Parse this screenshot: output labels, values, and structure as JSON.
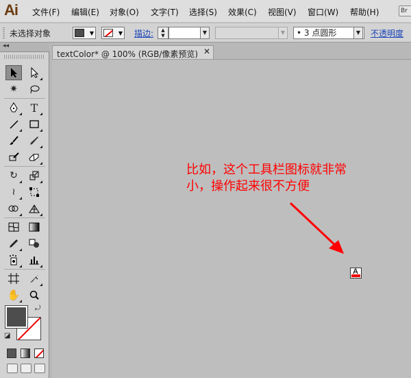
{
  "app": {
    "logo": "Ai",
    "bridge_badge": "Br"
  },
  "menu": [
    "文件(F)",
    "编辑(E)",
    "对象(O)",
    "文字(T)",
    "选择(S)",
    "效果(C)",
    "视图(V)",
    "窗口(W)",
    "帮助(H)"
  ],
  "control": {
    "selection_label": "未选择对象",
    "stroke_label": "描边:",
    "brush_value": "• 3 点圆形",
    "opacity_label": "不透明度",
    "fill_color": "#4d4d4d",
    "stroke_color": "none"
  },
  "document": {
    "tab_title": "textColor* @ 100% (RGB/像素预览)",
    "close_glyph": "✕"
  },
  "annotation": {
    "text": "比如，这个工具栏图标就非常小，操作起来很不方便",
    "color": "#ff0000"
  },
  "colors": {
    "canvas_bg": "#bebebe",
    "panel_bg": "#d3d3d3",
    "accent_red": "#ff0000"
  },
  "tools": [
    {
      "icon": "selection-arrow-icon"
    },
    {
      "icon": "direct-selection-icon"
    },
    {
      "icon": "magic-wand-icon"
    },
    {
      "icon": "lasso-icon"
    },
    {
      "icon": "pen-icon"
    },
    {
      "icon": "type-icon"
    },
    {
      "icon": "line-segment-icon"
    },
    {
      "icon": "rectangle-icon"
    },
    {
      "icon": "paintbrush-icon"
    },
    {
      "icon": "pencil-icon"
    },
    {
      "icon": "blob-brush-icon"
    },
    {
      "icon": "eraser-icon"
    },
    {
      "icon": "rotate-icon"
    },
    {
      "icon": "scale-icon"
    },
    {
      "icon": "width-icon"
    },
    {
      "icon": "free-transform-icon"
    },
    {
      "icon": "shape-builder-icon"
    },
    {
      "icon": "perspective-grid-icon"
    },
    {
      "icon": "mesh-icon"
    },
    {
      "icon": "gradient-icon"
    },
    {
      "icon": "eyedropper-icon"
    },
    {
      "icon": "blend-icon"
    },
    {
      "icon": "symbol-sprayer-icon"
    },
    {
      "icon": "column-graph-icon"
    },
    {
      "icon": "artboard-icon"
    },
    {
      "icon": "slice-icon"
    },
    {
      "icon": "hand-icon"
    },
    {
      "icon": "zoom-icon"
    }
  ]
}
